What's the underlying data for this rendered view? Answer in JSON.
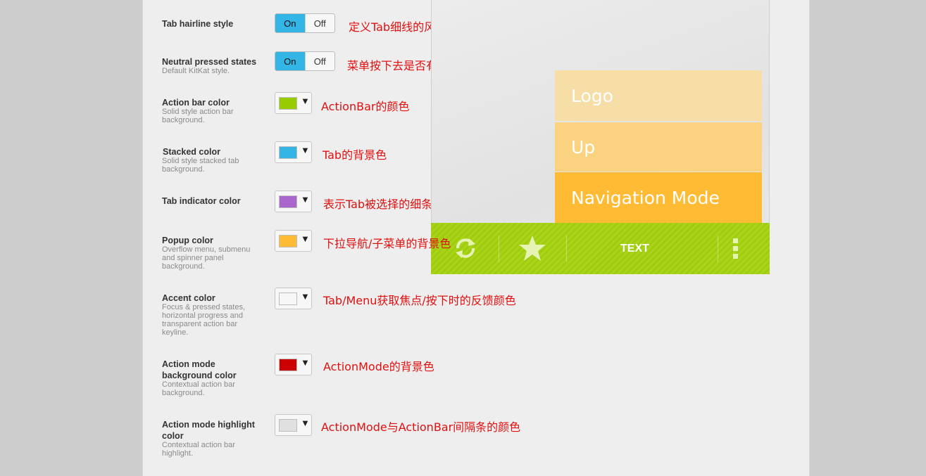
{
  "settings": {
    "tab_hairline": {
      "label": "Tab hairline style",
      "on": "On",
      "off": "Off",
      "note": "定义Tab细线的风格，没看出有什么效果"
    },
    "neutral_pressed": {
      "label": "Neutral pressed states",
      "sub": "Default KitKat style.",
      "on": "On",
      "off": "Off",
      "note": "菜单按下去是否有反馈状态"
    },
    "action_bar_color": {
      "label": "Action bar color",
      "sub1": "Solid style action bar",
      "sub2": "background.",
      "color": "#99cc00",
      "note": "ActionBar的颜色"
    },
    "stacked_color": {
      "label": "Stacked color",
      "sub1": "Solid style stacked tab",
      "sub2": "background.",
      "color": "#33b5e5",
      "note": "Tab的背景色"
    },
    "tab_indicator_color": {
      "label": "Tab indicator color",
      "color": "#aa66cc",
      "note": "表示Tab被选择的细条的颜色"
    },
    "popup_color": {
      "label": "Popup color",
      "sub1": "Overflow menu, submenu",
      "sub2": "and spinner panel",
      "sub3": "background.",
      "color": "#ffbb33",
      "note": "下拉导航/子菜单的背景色"
    },
    "accent_color": {
      "label": "Accent color",
      "sub1": "Focus & pressed states,",
      "sub2": "horizontal progress and",
      "sub3": "transparent action bar",
      "sub4": "keyline.",
      "color": "#f7f7f7",
      "note": "Tab/Menu获取焦点/按下时的反馈颜色"
    },
    "action_mode_bg": {
      "label1": "Action mode",
      "label2": "background color",
      "sub1": "Contextual action bar",
      "sub2": "background.",
      "color": "#cc0000",
      "note": "ActionMode的背景色"
    },
    "action_mode_highlight": {
      "label1": "Action mode highlight",
      "label2": "color",
      "sub1": "Contextual action bar",
      "sub2": "highlight.",
      "color": "#e0e0e0",
      "note": "ActionMode与ActionBar间隔条的颜色"
    }
  },
  "preview": {
    "menu_items": [
      "Logo",
      "Up",
      "Navigation Mode"
    ],
    "menu_colors": [
      "#f7dea6",
      "#fbd27f",
      "#ffbb33"
    ],
    "action_bar": {
      "text": "TEXT",
      "icons": [
        "refresh-icon",
        "star-icon",
        "overflow-icon"
      ],
      "color": "#99cc00"
    }
  }
}
